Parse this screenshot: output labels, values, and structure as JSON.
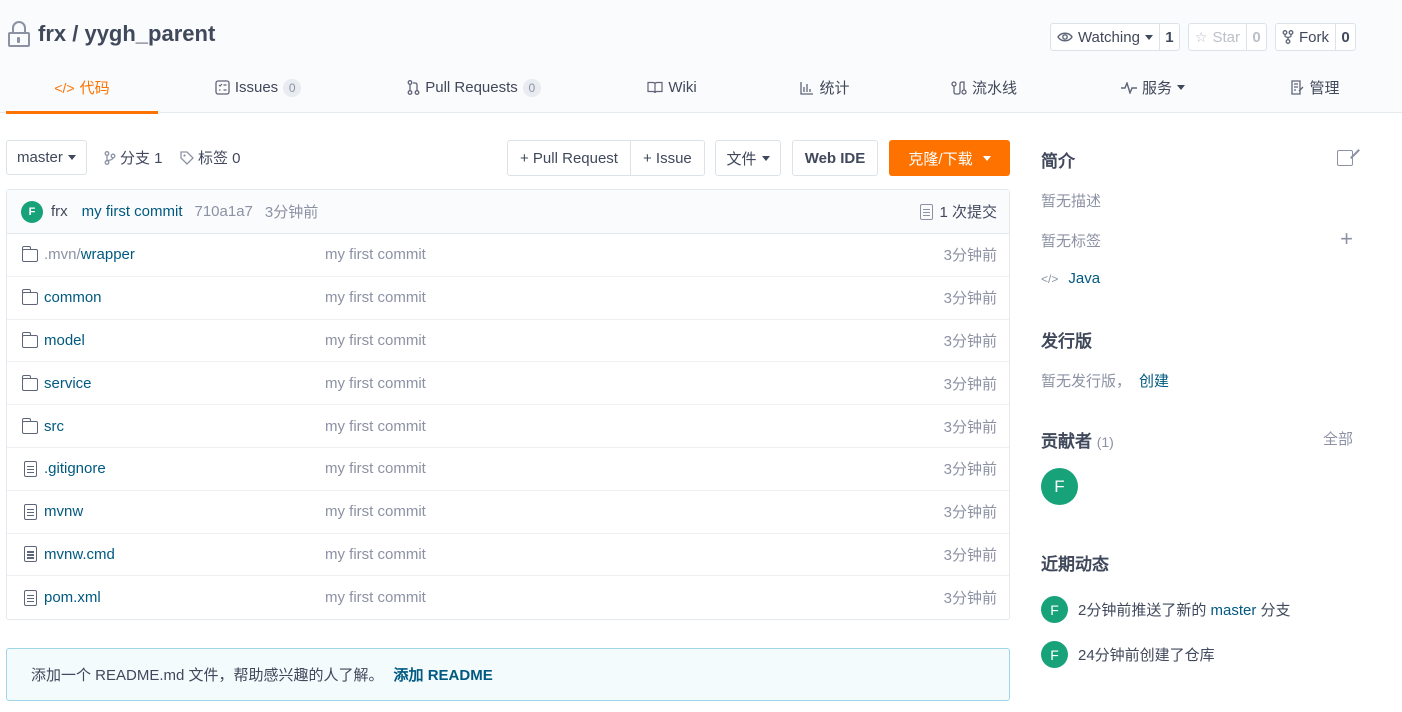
{
  "repo": {
    "title": "frx / yygh_parent"
  },
  "header_actions": [
    {
      "label": "Watching",
      "count": "1",
      "icon": "eye-icon"
    },
    {
      "label": "Star",
      "count": "0",
      "icon": "star-icon"
    },
    {
      "label": "Fork",
      "count": "0",
      "icon": "fork-icon"
    }
  ],
  "tabs": [
    {
      "label": "代码",
      "icon": "code-icon"
    },
    {
      "label": "Issues",
      "badge": "0",
      "icon": "issues-icon"
    },
    {
      "label": "Pull Requests",
      "badge": "0",
      "icon": "pull-request-icon"
    },
    {
      "label": "Wiki",
      "icon": "wiki-icon"
    },
    {
      "label": "统计",
      "icon": "chart-icon"
    },
    {
      "label": "流水线",
      "icon": "pipeline-icon"
    },
    {
      "label": "服务",
      "icon": "pulse-icon"
    },
    {
      "label": "管理",
      "icon": "manage-icon"
    }
  ],
  "toolbar": {
    "branch": "master",
    "branches": "分支 1",
    "tags": "标签 0",
    "pull_request": "+ Pull Request",
    "issue": "+ Issue",
    "file": "文件",
    "web_ide": "Web IDE",
    "clone": "克隆/下载"
  },
  "last_commit": {
    "avatar": "F",
    "author": "frx",
    "message": "my first commit",
    "sha": "710a1a7",
    "time": "3分钟前",
    "count": "1 次提交"
  },
  "files": [
    {
      "type": "folder",
      "name_dim": ".mvn/",
      "name": "wrapper",
      "message": "my first commit",
      "time": "3分钟前"
    },
    {
      "type": "folder",
      "name_dim": "",
      "name": "common",
      "message": "my first commit",
      "time": "3分钟前"
    },
    {
      "type": "folder",
      "name_dim": "",
      "name": "model",
      "message": "my first commit",
      "time": "3分钟前"
    },
    {
      "type": "folder",
      "name_dim": "",
      "name": "service",
      "message": "my first commit",
      "time": "3分钟前"
    },
    {
      "type": "folder",
      "name_dim": "",
      "name": "src",
      "message": "my first commit",
      "time": "3分钟前"
    },
    {
      "type": "file",
      "name_dim": "",
      "name": ".gitignore",
      "message": "my first commit",
      "time": "3分钟前"
    },
    {
      "type": "file",
      "name_dim": "",
      "name": "mvnw",
      "message": "my first commit",
      "time": "3分钟前"
    },
    {
      "type": "file",
      "name_dim": "",
      "name": "mvnw.cmd",
      "message": "my first commit",
      "time": "3分钟前"
    },
    {
      "type": "file",
      "name_dim": "",
      "name": "pom.xml",
      "message": "my first commit",
      "time": "3分钟前"
    }
  ],
  "readme": {
    "text": "添加一个 README.md 文件，帮助感兴趣的人了解。",
    "link": "添加 README"
  },
  "sidebar": {
    "intro_title": "简介",
    "no_desc": "暂无描述",
    "no_tags": "暂无标签",
    "language": "Java",
    "release_title": "发行版",
    "no_release": "暂无发行版，",
    "create": "创建",
    "contributors_title": "贡献者",
    "contributors_count": "(1)",
    "all": "全部",
    "contributor_avatar": "F",
    "activity_title": "近期动态",
    "activities": [
      {
        "avatar": "F",
        "before": "2分钟前推送了新的 ",
        "highlight": "master",
        "after": " 分支"
      },
      {
        "avatar": "F",
        "before": "24分钟前创建了仓库",
        "highlight": "",
        "after": ""
      }
    ]
  },
  "colors": {
    "accent": "#fe7300",
    "link": "#005980",
    "avatar": "#17a27a"
  }
}
